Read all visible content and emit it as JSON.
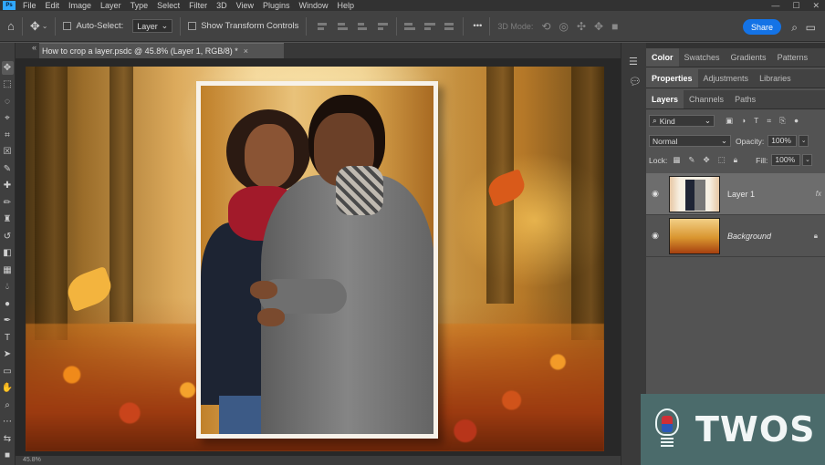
{
  "menubar": {
    "app_icon": "Ps",
    "items": [
      "File",
      "Edit",
      "Image",
      "Layer",
      "Type",
      "Select",
      "Filter",
      "3D",
      "View",
      "Plugins",
      "Window",
      "Help"
    ],
    "window_controls": [
      "—",
      "☐",
      "✕"
    ]
  },
  "options": {
    "auto_select_label": "Auto-Select:",
    "auto_select_target": "Layer",
    "show_transform_label": "Show Transform Controls",
    "more_label": "•••",
    "mode_3d_label": "3D Mode:",
    "share_label": "Share"
  },
  "document": {
    "tab_title": "How to crop a layer.psdc @ 45.8% (Layer 1, RGB/8) *",
    "close_glyph": "×",
    "status_text": "45.8%"
  },
  "panels": {
    "row1_tabs": [
      "Color",
      "Swatches",
      "Gradients",
      "Patterns"
    ],
    "row2_tabs": [
      "Properties",
      "Adjustments",
      "Libraries"
    ],
    "row3_tabs": [
      "Layers",
      "Channels",
      "Paths"
    ],
    "filter_kind": "Kind",
    "blend_mode": "Normal",
    "opacity_label": "Opacity:",
    "opacity_value": "100%",
    "lock_label": "Lock:",
    "fill_label": "Fill:",
    "fill_value": "100%",
    "layers": [
      {
        "name": "Layer 1",
        "badge": "fx",
        "selected": true
      },
      {
        "name": "Background",
        "badge": "lock-icon",
        "selected": false
      }
    ]
  },
  "watermark": {
    "text": "TWOS"
  },
  "colors": {
    "accent": "#1473e6",
    "panel_bg": "#535353",
    "app_bg": "#323232"
  }
}
